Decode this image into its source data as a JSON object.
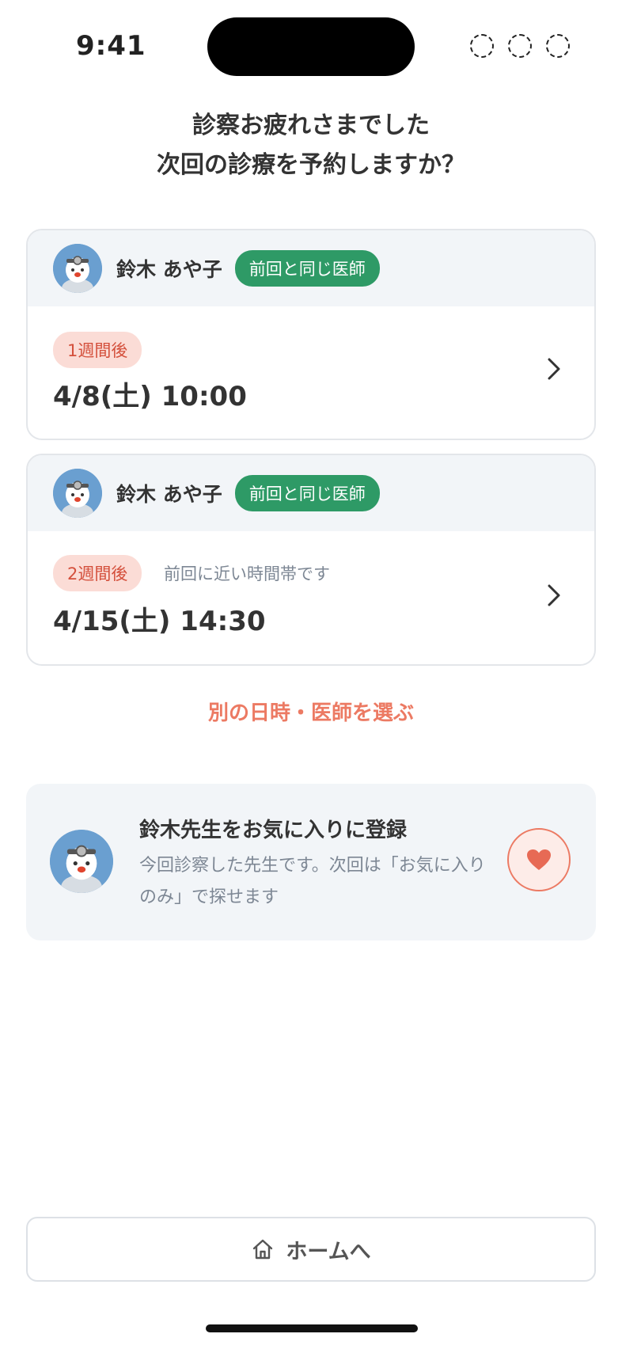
{
  "status_bar": {
    "time": "9:41",
    "icons": [
      "dashed-circle-icon",
      "dashed-circle-icon",
      "dashed-circle-icon"
    ]
  },
  "heading": {
    "line1": "診察お疲れさまでした",
    "line2": "次回の診療を予約しますか？"
  },
  "slots": [
    {
      "doctor_name": "鈴木 あや子",
      "badge": "前回と同じ医師",
      "period": "1週間後",
      "note": "",
      "datetime": "4/8(土) 10:00"
    },
    {
      "doctor_name": "鈴木 あや子",
      "badge": "前回と同じ医師",
      "period": "2週間後",
      "note": "前回に近い時間帯です",
      "datetime": "4/15(土) 14:30"
    }
  ],
  "alt_link": "別の日時・医師を選ぶ",
  "favorite": {
    "title": "鈴木先生をお気に入りに登録",
    "description": "今回診察した先生です。次回は「お気に入りのみ」で探せます"
  },
  "home_button": {
    "label": "ホームへ",
    "icon": "home-icon"
  },
  "colors": {
    "accent": "#ec7a63",
    "badge_green": "#2e9a66",
    "period_bg": "#fbdcd6",
    "period_text": "#d4503c",
    "panel_bg": "#f2f5f8"
  }
}
